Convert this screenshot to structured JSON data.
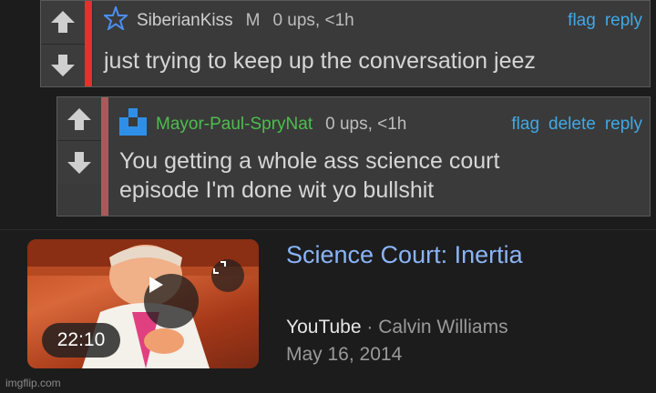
{
  "comment1": {
    "username": "SiberianKiss",
    "badge": "M",
    "stats": "0 ups, <1h",
    "links": [
      "flag",
      "reply"
    ],
    "text": "just trying to keep up the conversation jeez"
  },
  "comment2": {
    "username": "Mayor-Paul-SpryNat",
    "stats": "0 ups, <1h",
    "links": [
      "flag",
      "delete",
      "reply"
    ],
    "text_line1": "You getting a whole ass science court",
    "text_line2": "episode I'm done wit yo bullshit"
  },
  "video": {
    "title": "Science Court: Inertia",
    "source": "YouTube",
    "separator": "·",
    "author": "Calvin Williams",
    "date": "May 16, 2014",
    "duration": "22:10"
  },
  "watermark": "imgflip.com",
  "colors": {
    "link": "#3fa9e6",
    "vote_bar_c1": "#e53030",
    "vote_bar_c2": "#a85a5a",
    "username_green": "#4cbf4c",
    "video_title": "#8ab4f8"
  }
}
